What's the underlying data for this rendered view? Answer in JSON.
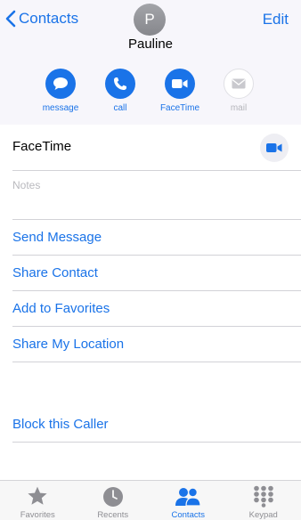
{
  "nav": {
    "back_label": "Contacts",
    "edit_label": "Edit"
  },
  "contact": {
    "initial": "P",
    "name": "Pauline"
  },
  "actions": [
    {
      "label": "message",
      "icon": "message-bubble-icon",
      "enabled": true
    },
    {
      "label": "call",
      "icon": "phone-icon",
      "enabled": true
    },
    {
      "label": "FaceTime",
      "icon": "video-camera-icon",
      "enabled": true
    },
    {
      "label": "mail",
      "icon": "envelope-icon",
      "enabled": false
    }
  ],
  "facetime_row": {
    "label": "FaceTime",
    "icon": "video-camera-icon"
  },
  "notes": {
    "placeholder": "Notes"
  },
  "links": {
    "send_message": "Send Message",
    "share_contact": "Share Contact",
    "add_favorites": "Add to Favorites",
    "share_location": "Share My Location",
    "block_caller": "Block this Caller"
  },
  "tabs": [
    {
      "label": "Favorites",
      "icon": "star-icon",
      "active": false
    },
    {
      "label": "Recents",
      "icon": "clock-icon",
      "active": false
    },
    {
      "label": "Contacts",
      "icon": "contacts-people-icon",
      "active": true
    },
    {
      "label": "Keypad",
      "icon": "keypad-icon",
      "active": false
    }
  ],
  "colors": {
    "accent": "#1a73e8",
    "header_bg": "#f7f6fb",
    "avatar_gray": "#9a9ba0",
    "divider": "#d2d2d7",
    "tab_inactive": "#8e8e93"
  }
}
